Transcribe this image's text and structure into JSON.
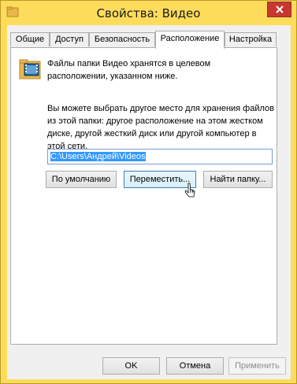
{
  "window": {
    "title": "Свойства: Видео"
  },
  "tabs": [
    {
      "label": "Общие"
    },
    {
      "label": "Доступ"
    },
    {
      "label": "Безопасность"
    },
    {
      "label": "Расположение"
    },
    {
      "label": "Настройка"
    }
  ],
  "panel": {
    "info_text": "Файлы папки Видео хранятся в целевом расположении, указанном ниже.",
    "help_text": "Вы можете выбрать другое место для хранения файлов из этой папки: другое расположение на этом жестком диске, другой жесткий диск или другой компьютер в этой сети.",
    "path_value": "C:\\Users\\Андрей\\Videos",
    "default_button": "По умолчанию",
    "move_button": "Переместить...",
    "find_button": "Найти папку..."
  },
  "footer": {
    "ok": "OK",
    "cancel": "Отмена",
    "apply": "Применить"
  },
  "colors": {
    "frame": "#fedc5b",
    "close": "#c7372f",
    "selection": "#3399ff"
  }
}
